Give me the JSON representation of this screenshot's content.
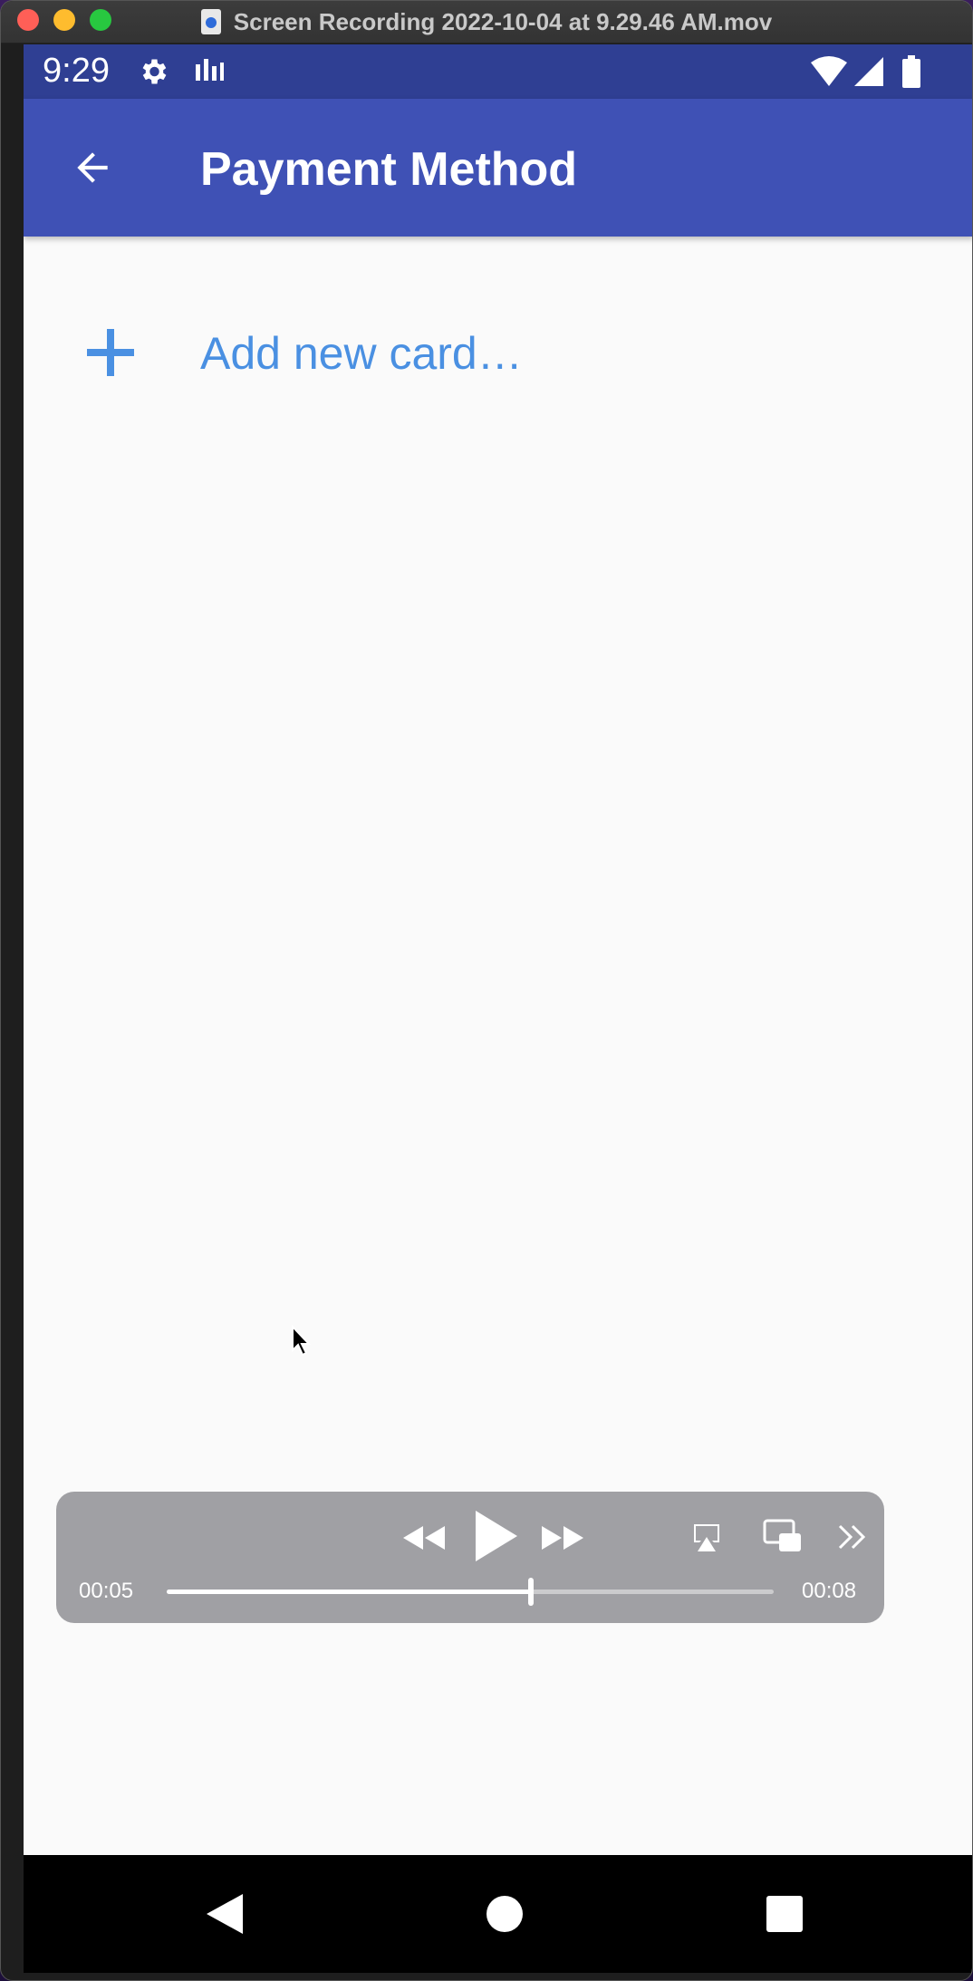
{
  "window": {
    "title": "Screen Recording 2022-10-04 at 9.29.46 AM.mov"
  },
  "statusbar": {
    "time": "9:29",
    "icons": [
      "settings-icon",
      "signal-bars-icon",
      "wifi-icon",
      "cellular-icon",
      "battery-icon"
    ]
  },
  "appbar": {
    "title": "Payment Method",
    "back_icon": "back-arrow-icon"
  },
  "content": {
    "add_card_label": "Add new card…",
    "add_icon": "plus-icon",
    "accent_color": "#4a90e2"
  },
  "player": {
    "current_time": "00:05",
    "total_time": "00:08",
    "progress": 0.6,
    "buttons": [
      "rewind",
      "play",
      "fast-forward",
      "airplay",
      "picture-in-picture",
      "more"
    ]
  },
  "navbar": {
    "buttons": [
      "back-triangle-icon",
      "home-circle-icon",
      "recents-square-icon"
    ]
  },
  "colors": {
    "statusbar": "#2f3f93",
    "appbar": "#3f51b5",
    "background": "#fafafa"
  }
}
